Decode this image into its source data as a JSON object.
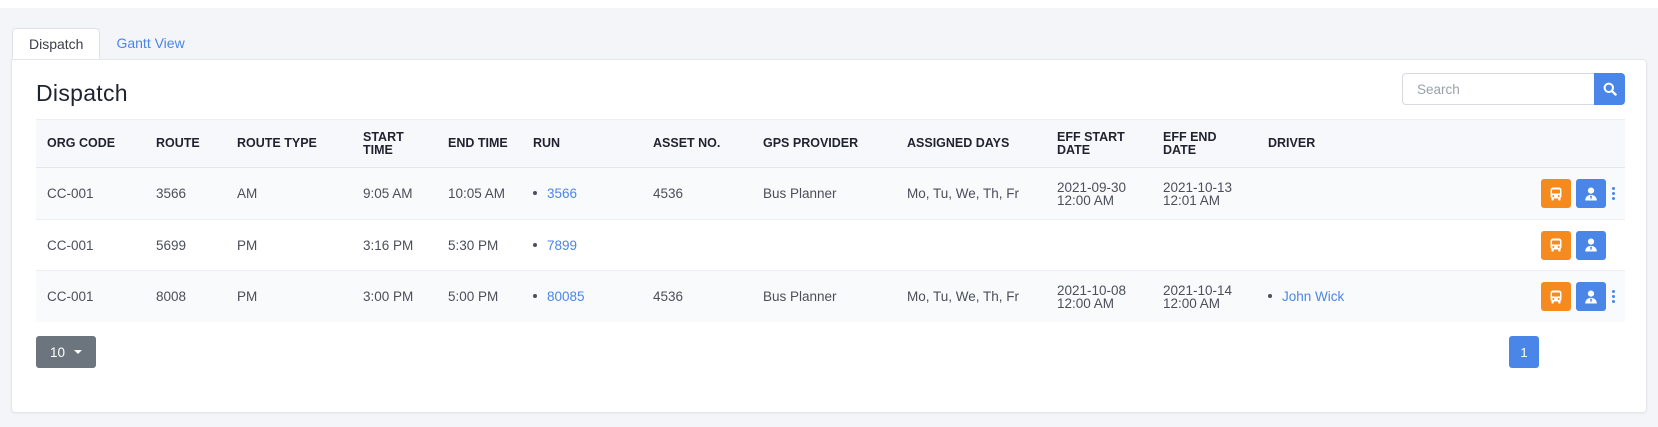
{
  "tabs": [
    {
      "label": "Dispatch",
      "active": true
    },
    {
      "label": "Gantt View",
      "active": false
    }
  ],
  "page_title": "Dispatch",
  "search": {
    "placeholder": "Search",
    "value": ""
  },
  "table": {
    "headers": {
      "org_code": "ORG CODE",
      "route": "ROUTE",
      "route_type": "ROUTE TYPE",
      "start_time_1": "START",
      "start_time_2": "TIME",
      "end_time": "END TIME",
      "run": "RUN",
      "asset_no": "ASSET NO.",
      "gps_provider": "GPS PROVIDER",
      "assigned_days": "ASSIGNED DAYS",
      "eff_start_1": "EFF START",
      "eff_start_2": "DATE",
      "eff_end_1": "EFF END",
      "eff_end_2": "DATE",
      "driver": "DRIVER"
    },
    "rows": [
      {
        "org_code": "CC-001",
        "route": "3566",
        "route_type": "AM",
        "start_time": "9:05 AM",
        "end_time": "10:05 AM",
        "run": "3566",
        "asset_no": "4536",
        "gps_provider": "Bus Planner",
        "assigned_days": "Mo, Tu, We, Th, Fr",
        "eff_start_date": "2021-09-30",
        "eff_start_time": "12:00 AM",
        "eff_end_date": "2021-10-13",
        "eff_end_time": "12:01 AM",
        "driver": ""
      },
      {
        "org_code": "CC-001",
        "route": "5699",
        "route_type": "PM",
        "start_time": "3:16 PM",
        "end_time": "5:30 PM",
        "run": "7899",
        "asset_no": "",
        "gps_provider": "",
        "assigned_days": "",
        "eff_start_date": "",
        "eff_start_time": "",
        "eff_end_date": "",
        "eff_end_time": "",
        "driver": ""
      },
      {
        "org_code": "CC-001",
        "route": "8008",
        "route_type": "PM",
        "start_time": "3:00 PM",
        "end_time": "5:00 PM",
        "run": "80085",
        "asset_no": "4536",
        "gps_provider": "Bus Planner",
        "assigned_days": "Mo, Tu, We, Th, Fr",
        "eff_start_date": "2021-10-08",
        "eff_start_time": "12:00 AM",
        "eff_end_date": "2021-10-14",
        "eff_end_time": "12:00 AM",
        "driver": "John Wick"
      }
    ]
  },
  "pagination": {
    "page_size": "10",
    "current_page": "1"
  },
  "icons": {
    "bus": "bus-icon",
    "driver": "driver-icon",
    "search": "search-icon",
    "more": "kebab-menu-icon"
  },
  "colors": {
    "accent": "#4a86e8",
    "bus_button": "#f58a1f",
    "page_size_button": "#6c757d"
  }
}
